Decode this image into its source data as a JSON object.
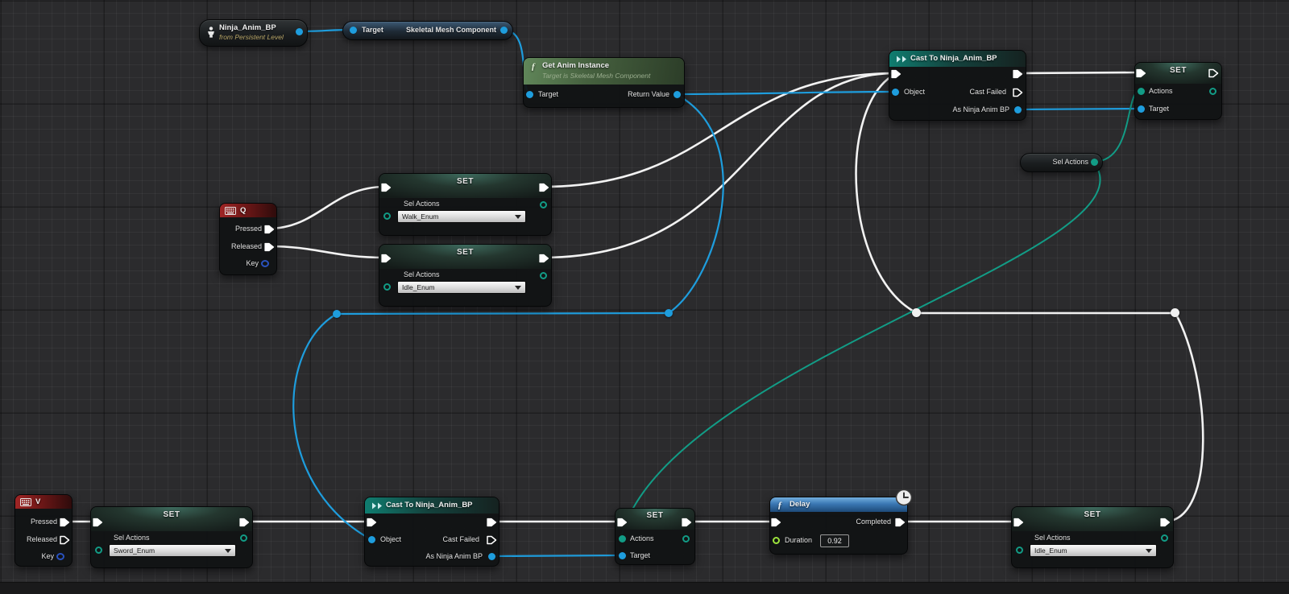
{
  "nodes": {
    "ninja_getter": {
      "title": "Ninja_Anim_BP",
      "subtitle": "from Persistent Level"
    },
    "skeletal_mesh": {
      "target_label": "Target",
      "output_label": "Skeletal Mesh Component"
    },
    "get_anim_instance": {
      "title": "Get Anim Instance",
      "subtitle": "Target is Skeletal Mesh Component",
      "target_label": "Target",
      "return_label": "Return Value"
    },
    "cast_top": {
      "title": "Cast To Ninja_Anim_BP",
      "object_label": "Object",
      "cast_failed_label": "Cast Failed",
      "as_label": "As Ninja Anim BP"
    },
    "set_top_right": {
      "title": "SET",
      "actions_label": "Actions",
      "target_label": "Target"
    },
    "sel_actions_getter": {
      "label": "Sel Actions"
    },
    "key_q": {
      "title": "Q",
      "pressed_label": "Pressed",
      "released_label": "Released",
      "key_label": "Key"
    },
    "set_walk": {
      "title": "SET",
      "pin_label": "Sel Actions",
      "value": "Walk_Enum"
    },
    "set_idle_mid": {
      "title": "SET",
      "pin_label": "Sel Actions",
      "value": "Idle_Enum"
    },
    "key_v": {
      "title": "V",
      "pressed_label": "Pressed",
      "released_label": "Released",
      "key_label": "Key"
    },
    "set_sword": {
      "title": "SET",
      "pin_label": "Sel Actions",
      "value": "Sword_Enum"
    },
    "cast_bottom": {
      "title": "Cast To Ninja_Anim_BP",
      "object_label": "Object",
      "cast_failed_label": "Cast Failed",
      "as_label": "As Ninja Anim BP"
    },
    "set_mid": {
      "title": "SET",
      "actions_label": "Actions",
      "target_label": "Target"
    },
    "delay": {
      "title": "Delay",
      "completed_label": "Completed",
      "duration_label": "Duration",
      "duration_value": "0.92"
    },
    "set_bottom_right": {
      "title": "SET",
      "pin_label": "Sel Actions",
      "value": "Idle_Enum"
    }
  },
  "icons": {
    "function_glyph": "ƒ"
  },
  "colors": {
    "exec_wire": "#f2f2f2",
    "object_pin": "#1e9ddd",
    "enum_pin": "#129c86",
    "float_pin": "#9ce33c",
    "key_pin": "#2a52be",
    "header_cast": "#117a6e",
    "header_function_green": "#5c8456",
    "header_delay": "#4a8cc7",
    "header_key_event": "#9b2424",
    "header_set": "#2f5a50",
    "grid_background": "#2b2b2d"
  }
}
